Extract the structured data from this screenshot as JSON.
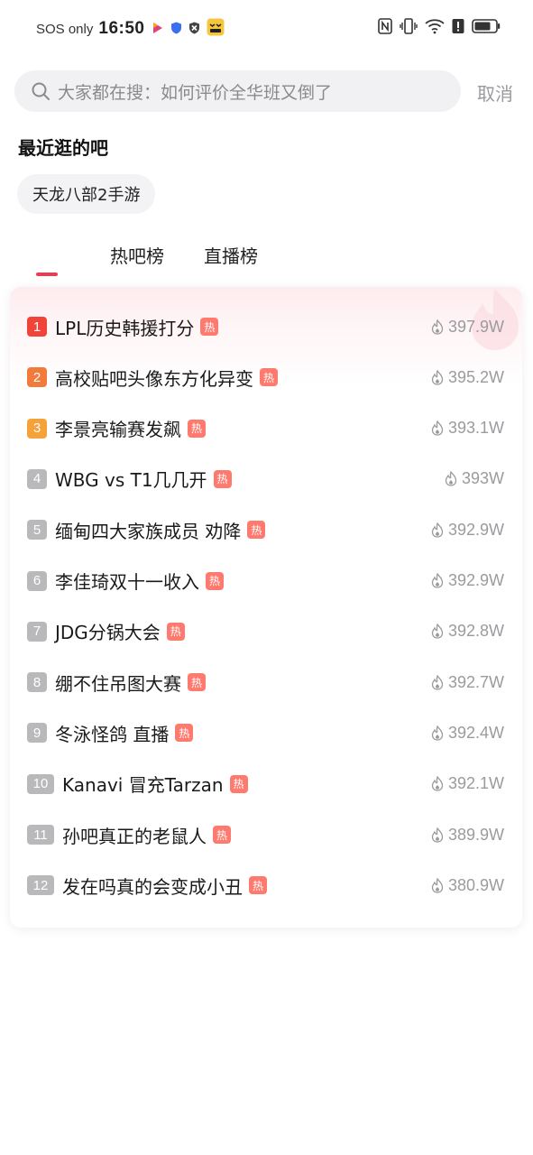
{
  "status_bar": {
    "carrier": "SOS only",
    "time": "16:50",
    "battery_color": "#333333"
  },
  "search": {
    "placeholder": "大家都在搜：如何评价全华班又倒了",
    "cancel_label": "取消"
  },
  "recent": {
    "title": "最近逛的吧",
    "items": [
      {
        "label": "天龙八部2手游"
      }
    ]
  },
  "tabs": {
    "active_index": 0,
    "items": [
      {
        "label": ""
      },
      {
        "label": "热吧榜"
      },
      {
        "label": "直播榜"
      }
    ]
  },
  "colors": {
    "accent": "#e5404f",
    "rank_1": "#f0443a",
    "rank_2": "#f27a3a",
    "rank_3": "#f5a23a",
    "rank_other": "#b9b9bc",
    "hot_badge": "#ff7a6e"
  },
  "hot_badge_label": "热",
  "ranking": [
    {
      "rank": "1",
      "title": "LPL历史韩援打分",
      "heat": "397.9W"
    },
    {
      "rank": "2",
      "title": "高校贴吧头像东方化异变",
      "heat": "395.2W"
    },
    {
      "rank": "3",
      "title": "李景亮输赛发飙",
      "heat": "393.1W"
    },
    {
      "rank": "4",
      "title": "WBG vs T1几几开",
      "heat": "393W"
    },
    {
      "rank": "5",
      "title": "缅甸四大家族成员 劝降",
      "heat": "392.9W"
    },
    {
      "rank": "6",
      "title": "李佳琦双十一收入",
      "heat": "392.9W"
    },
    {
      "rank": "7",
      "title": "JDG分锅大会",
      "heat": "392.8W"
    },
    {
      "rank": "8",
      "title": "绷不住吊图大赛",
      "heat": "392.7W"
    },
    {
      "rank": "9",
      "title": "冬泳怪鸽 直播",
      "heat": "392.4W"
    },
    {
      "rank": "10",
      "title": "Kanavi 冒充Tarzan",
      "heat": "392.1W"
    },
    {
      "rank": "11",
      "title": "孙吧真正的老鼠人",
      "heat": "389.9W"
    },
    {
      "rank": "12",
      "title": "发在吗真的会变成小丑",
      "heat": "380.9W"
    }
  ]
}
